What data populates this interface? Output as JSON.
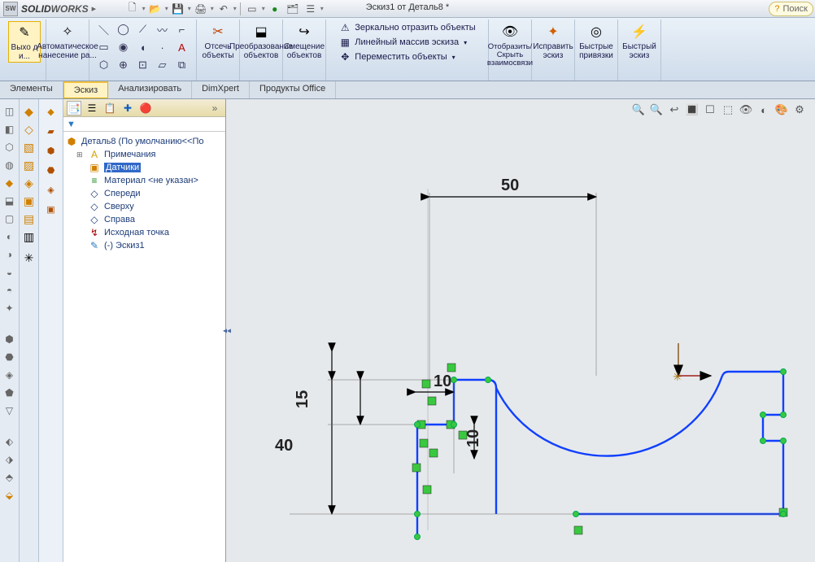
{
  "app": {
    "brand1": "SOLID",
    "brand2": "WORKS",
    "doc_title": "Эскиз1 от Деталь8 *",
    "search_label": "Поиск"
  },
  "ribbon": {
    "exit": "Выхо д и...",
    "auto_dim": "Автоматическое нанесение ра...",
    "trim": "Отсечь объекты",
    "convert": "Преобразование объектов",
    "offset": "Смещение объектов",
    "mirror": "Зеркально отразить объекты",
    "linear": "Линейный массив эскиза",
    "move": "Переместить объекты",
    "showhide": "Отобразить/Скрыть взаимосвязи",
    "repair": "Исправить эскиз",
    "quick": "Быстрые привязки",
    "rapid": "Быстрый эскиз"
  },
  "tabs": {
    "elements": "Элементы",
    "sketch": "Эскиз",
    "analyze": "Анализировать",
    "dimxpert": "DimXpert",
    "office": "Продукты Office"
  },
  "tree": {
    "root": "Деталь8  (По умолчанию<<По",
    "annotations": "Примечания",
    "sensors": "Датчики",
    "material": "Материал <не указан>",
    "front": "Спереди",
    "top": "Сверху",
    "right": "Справа",
    "origin": "Исходная точка",
    "sketch1": "(-) Эскиз1"
  },
  "dims": {
    "d50": "50",
    "d40": "40",
    "d15": "15",
    "d10a": "10",
    "d10b": "10"
  }
}
